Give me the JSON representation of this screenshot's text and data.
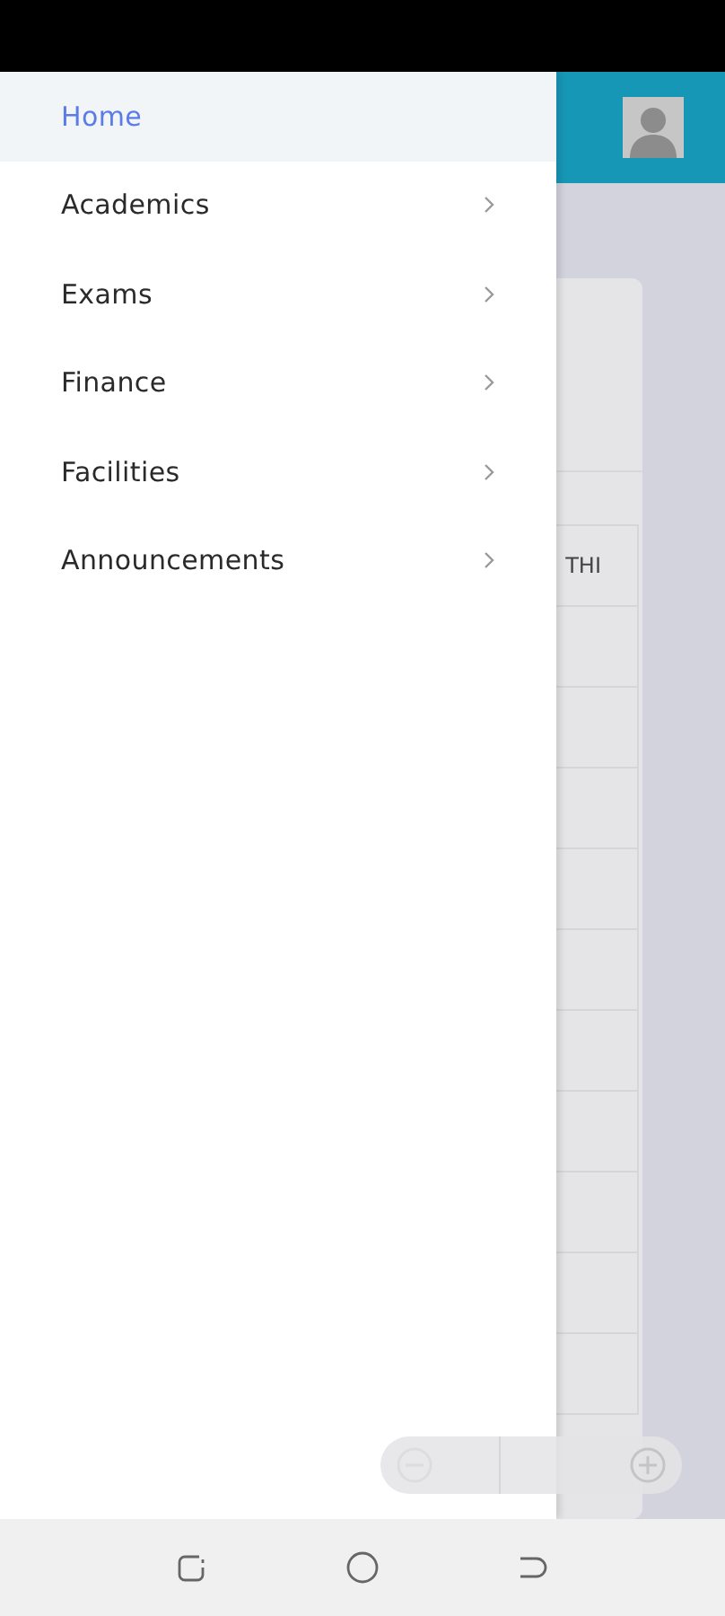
{
  "drawer": {
    "items": [
      {
        "label": "Home",
        "selected": true,
        "expandable": false
      },
      {
        "label": "Academics",
        "selected": false,
        "expandable": true
      },
      {
        "label": "Exams",
        "selected": false,
        "expandable": true
      },
      {
        "label": "Finance",
        "selected": false,
        "expandable": true
      },
      {
        "label": "Facilities",
        "selected": false,
        "expandable": true
      },
      {
        "label": "Announcements",
        "selected": false,
        "expandable": true
      }
    ]
  },
  "page": {
    "table": {
      "cell_text": "THI"
    }
  }
}
